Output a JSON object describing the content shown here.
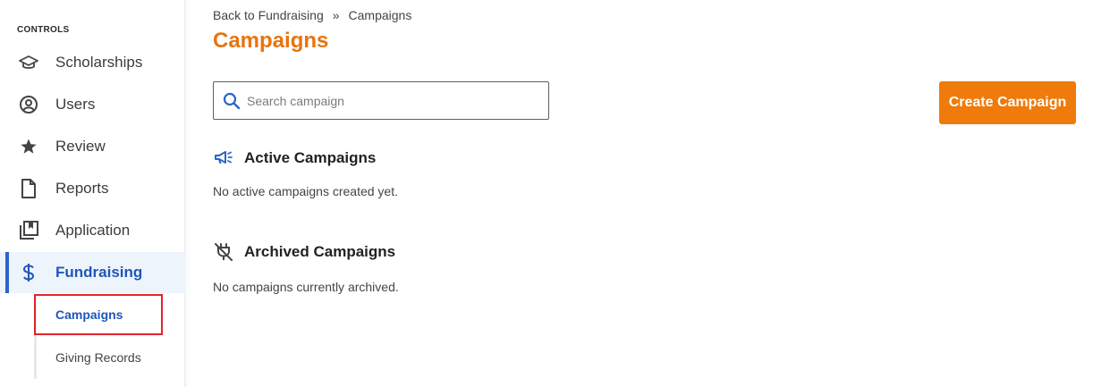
{
  "sidebar": {
    "section_label": "CONTROLS",
    "items": [
      {
        "label": "Scholarships",
        "icon": "graduation-cap-icon"
      },
      {
        "label": "Users",
        "icon": "user-circle-icon"
      },
      {
        "label": "Review",
        "icon": "star-icon"
      },
      {
        "label": "Reports",
        "icon": "document-icon"
      },
      {
        "label": "Application",
        "icon": "book-stack-icon"
      },
      {
        "label": "Fundraising",
        "icon": "dollar-icon",
        "active": true
      }
    ],
    "sub_items": [
      {
        "label": "Campaigns",
        "current": true
      },
      {
        "label": "Giving Records"
      }
    ]
  },
  "breadcrumb": {
    "back_link": "Back to Fundraising",
    "separator": "»",
    "current": "Campaigns"
  },
  "page": {
    "title": "Campaigns"
  },
  "search": {
    "placeholder": "Search campaign",
    "value": ""
  },
  "actions": {
    "create_label": "Create Campaign"
  },
  "sections": {
    "active": {
      "title": "Active Campaigns",
      "icon": "megaphone-icon",
      "empty_text": "No active campaigns created yet."
    },
    "archived": {
      "title": "Archived Campaigns",
      "icon": "unplugged-icon",
      "empty_text": "No campaigns currently archived."
    }
  },
  "colors": {
    "accent_orange": "#ee7b0b",
    "title_orange": "#e8740f",
    "active_blue": "#1f56b8",
    "active_bg": "#eef4fc",
    "highlight_red": "#e0252c"
  }
}
